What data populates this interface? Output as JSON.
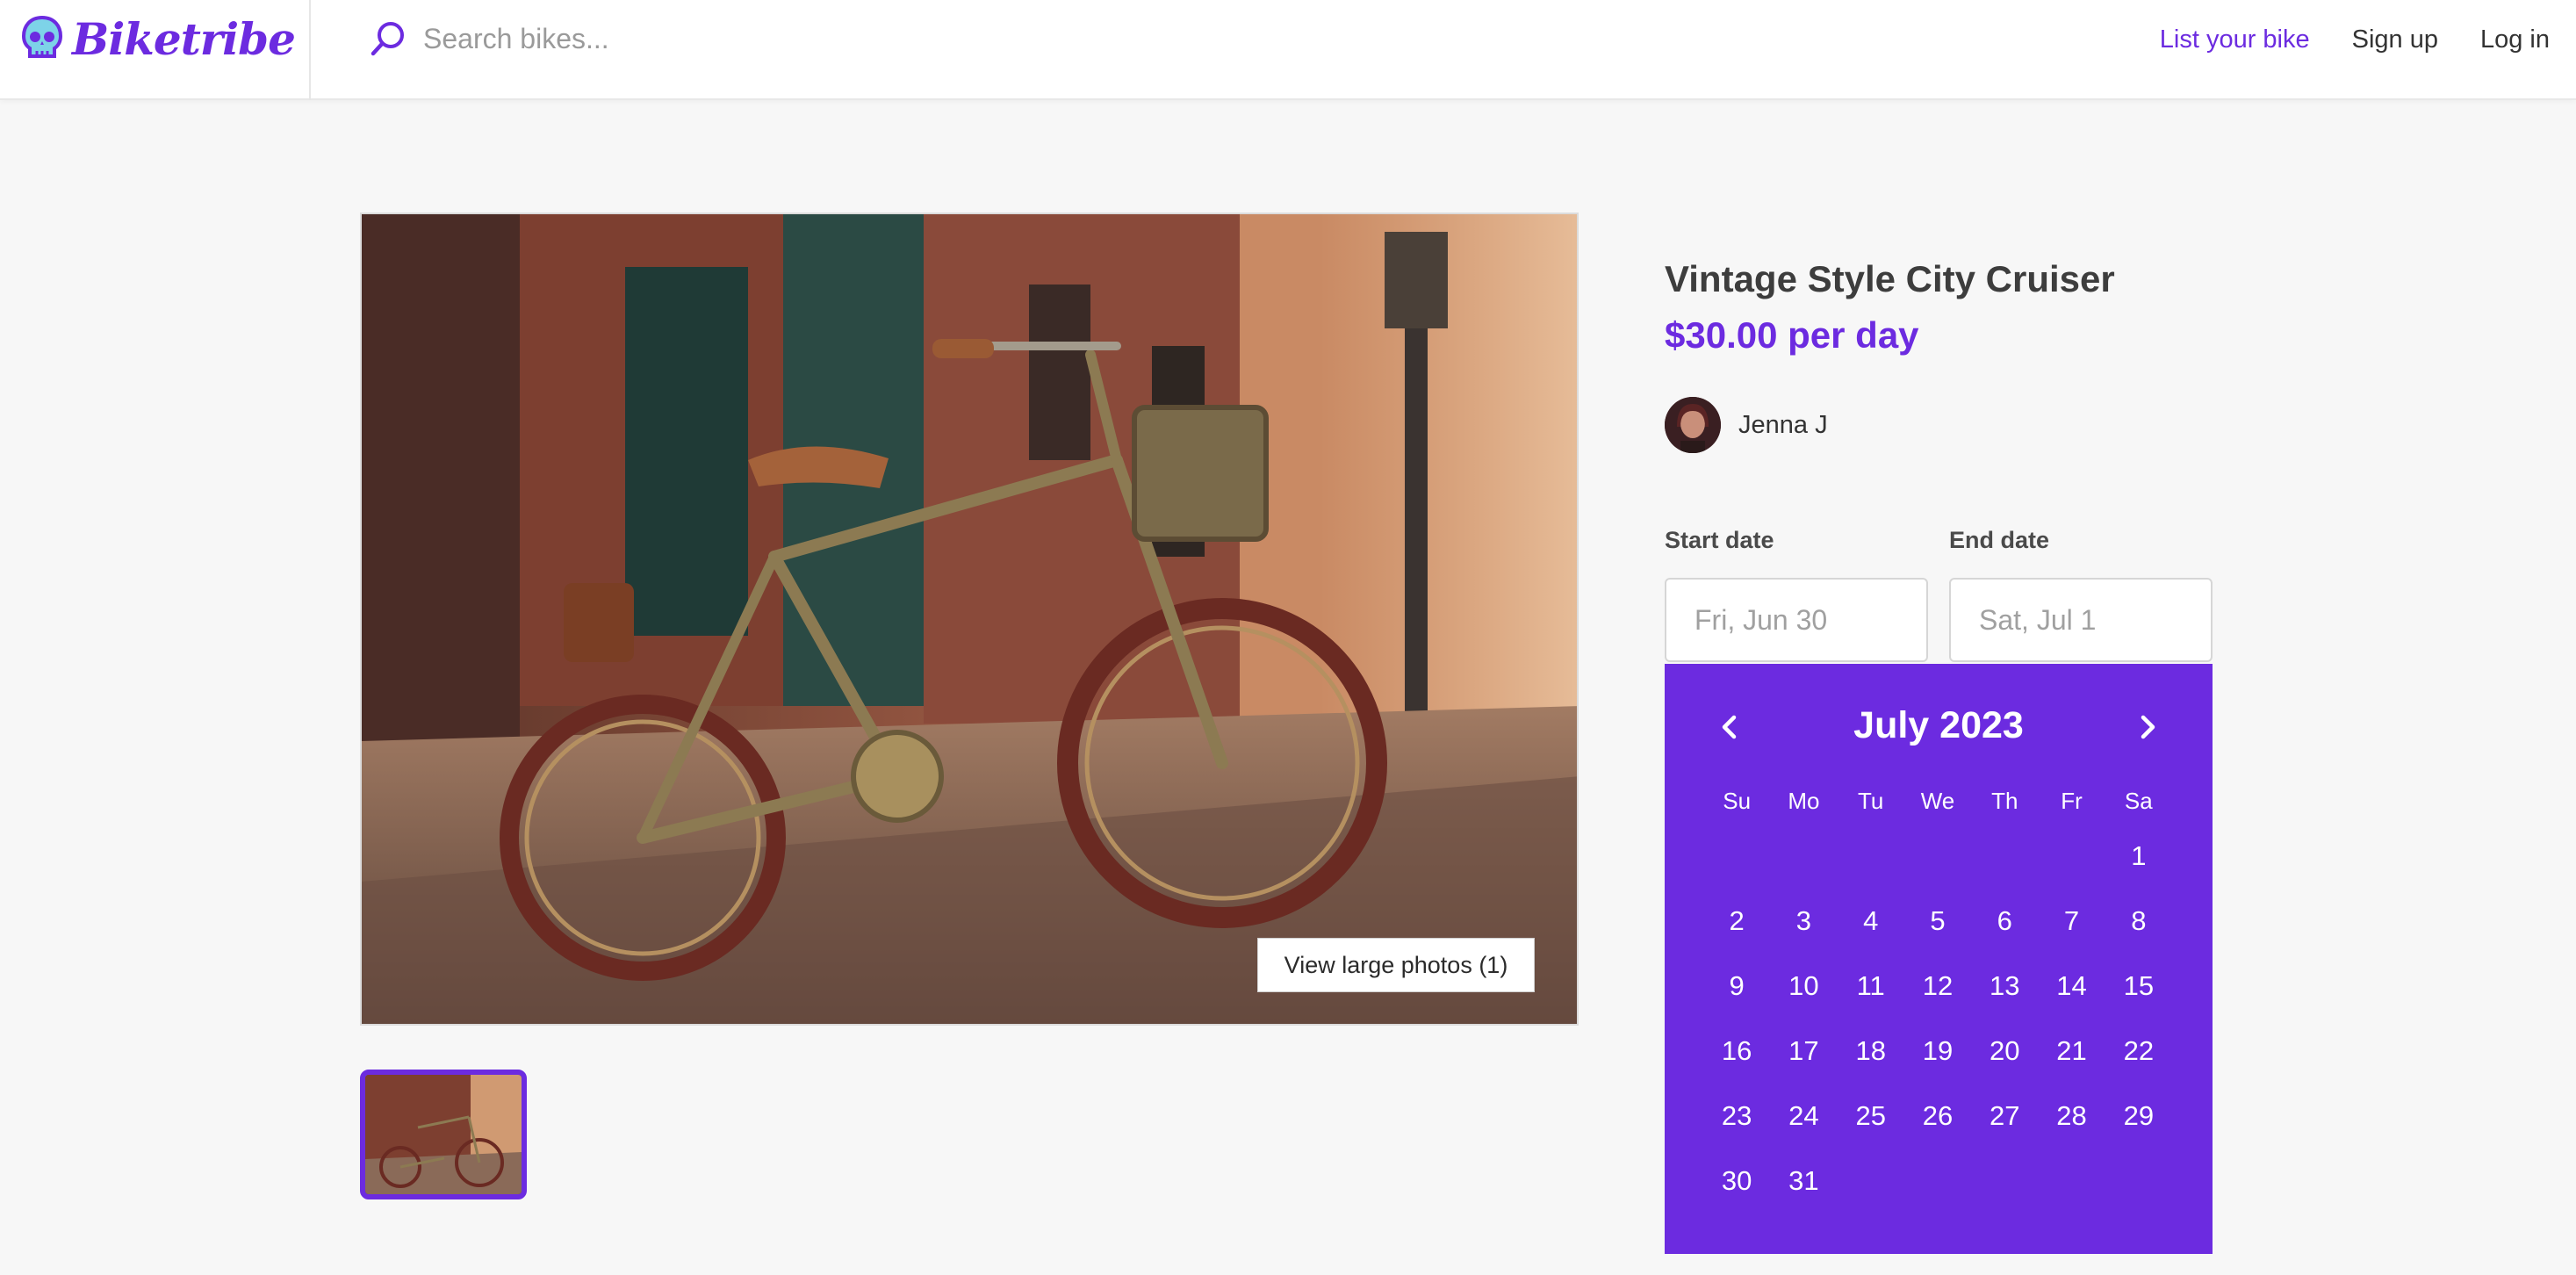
{
  "header": {
    "logo_text": "Biketribe",
    "search_placeholder": "Search bikes...",
    "nav": {
      "list_bike": "List your bike",
      "sign_up": "Sign up",
      "log_in": "Log in"
    }
  },
  "listing": {
    "title": "Vintage Style City Cruiser",
    "price": "$30.00 per day",
    "owner_name": "Jenna J",
    "view_photos_label": "View large photos (1)"
  },
  "booking": {
    "start_label": "Start date",
    "end_label": "End date",
    "start_placeholder": "Fri, Jun 30",
    "end_placeholder": "Sat, Jul 1"
  },
  "calendar": {
    "month_label": "July 2023",
    "weekdays": [
      "Su",
      "Mo",
      "Tu",
      "We",
      "Th",
      "Fr",
      "Sa"
    ],
    "weeks": [
      [
        "",
        "",
        "",
        "",
        "",
        "",
        "1"
      ],
      [
        "2",
        "3",
        "4",
        "5",
        "6",
        "7",
        "8"
      ],
      [
        "9",
        "10",
        "11",
        "12",
        "13",
        "14",
        "15"
      ],
      [
        "16",
        "17",
        "18",
        "19",
        "20",
        "21",
        "22"
      ],
      [
        "23",
        "24",
        "25",
        "26",
        "27",
        "28",
        "29"
      ],
      [
        "30",
        "31",
        "",
        "",
        "",
        "",
        ""
      ]
    ]
  },
  "colors": {
    "brand": "#6c2be0",
    "background": "#f7f7f7",
    "text": "#3a3a3a"
  },
  "icons": {
    "logo": "skull-logo-icon",
    "search": "search-icon",
    "prev_month": "chevron-left-icon",
    "next_month": "chevron-right-icon"
  }
}
